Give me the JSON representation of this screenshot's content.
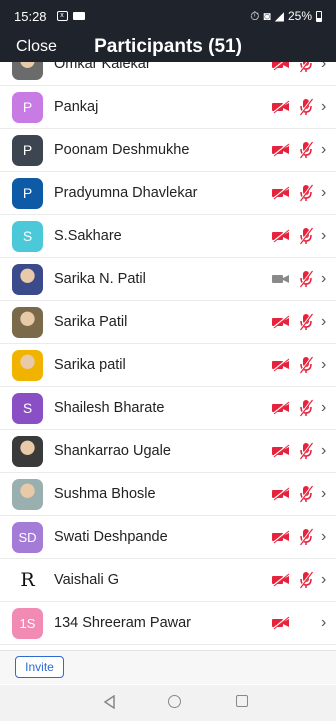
{
  "status_bar": {
    "time": "15:28",
    "battery": "25%"
  },
  "header": {
    "close": "Close",
    "title": "Participants (51)"
  },
  "participants": [
    {
      "name": "Omkar Kalekar",
      "avatar_type": "photo",
      "avatar_color": "#6b6b6b",
      "video": "off",
      "audio": "muted"
    },
    {
      "name": "Pankaj",
      "avatar_type": "initial",
      "avatar_text": "P",
      "avatar_color": "#c77be3",
      "video": "off",
      "audio": "muted"
    },
    {
      "name": "Poonam Deshmukhe",
      "avatar_type": "initial",
      "avatar_text": "P",
      "avatar_color": "#3d4650",
      "video": "off",
      "audio": "muted"
    },
    {
      "name": "Pradyumna Dhavlekar",
      "avatar_type": "initial",
      "avatar_text": "P",
      "avatar_color": "#0e5aa7",
      "video": "off",
      "audio": "muted"
    },
    {
      "name": "S.Sakhare",
      "avatar_type": "initial",
      "avatar_text": "S",
      "avatar_color": "#4cc9d8",
      "video": "off",
      "audio": "muted"
    },
    {
      "name": "Sarika N. Patil",
      "avatar_type": "photo",
      "avatar_color": "#3a4a8a",
      "video": "on",
      "audio": "muted"
    },
    {
      "name": "Sarika Patil",
      "avatar_type": "photo",
      "avatar_color": "#7a6a4a",
      "video": "off",
      "audio": "muted"
    },
    {
      "name": "Sarika patil",
      "avatar_type": "photo",
      "avatar_color": "#f0b400",
      "video": "off",
      "audio": "muted"
    },
    {
      "name": "Shailesh Bharate",
      "avatar_type": "initial",
      "avatar_text": "S",
      "avatar_color": "#8a4fc4",
      "video": "off",
      "audio": "muted"
    },
    {
      "name": "Shankarrao Ugale",
      "avatar_type": "photo",
      "avatar_color": "#3a3a3a",
      "video": "off",
      "audio": "muted"
    },
    {
      "name": "Sushma Bhosle",
      "avatar_type": "photo",
      "avatar_color": "#9ab0b0",
      "video": "off",
      "audio": "muted"
    },
    {
      "name": "Swati Deshpande",
      "avatar_type": "initial",
      "avatar_text": "SD",
      "avatar_color": "#a57bd8",
      "video": "off",
      "audio": "muted"
    },
    {
      "name": "Vaishali G",
      "avatar_type": "letter",
      "avatar_text": "R",
      "avatar_color": "#ffffff",
      "video": "off",
      "audio": "muted"
    },
    {
      "name": "134 Shreeram Pawar",
      "avatar_type": "initial",
      "avatar_text": "1S",
      "avatar_color": "#f28bb4",
      "video": "off",
      "audio": "none"
    }
  ],
  "footer": {
    "invite": "Invite"
  },
  "colors": {
    "muted_red": "#e5233c",
    "video_on_gray": "#8a8a8a",
    "header_bg": "#1f232b",
    "accent": "#2d6ad4"
  },
  "icons": {
    "video_off": "video-off-icon",
    "video_on": "video-on-icon",
    "mic_muted": "mic-muted-icon",
    "chevron": "chevron-right-icon"
  }
}
